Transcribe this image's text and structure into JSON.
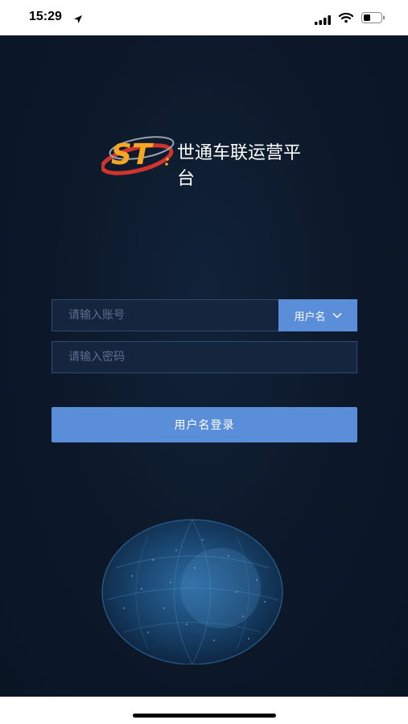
{
  "status_bar": {
    "time": "15:29",
    "icons": [
      "location-arrow-icon",
      "cellular-signal-icon",
      "wifi-icon",
      "battery-icon"
    ]
  },
  "logo": {
    "mark_text": "ST",
    "title": "世通车联运营平台"
  },
  "form": {
    "account_placeholder": "请输入账号",
    "login_type_label": "用户名",
    "password_placeholder": "请输入密码",
    "login_button_label": "用户名登录"
  },
  "colors": {
    "background": "#0c1829",
    "input_background": "#14253d",
    "input_border": "#2f4a73",
    "accent": "#5b8ed8",
    "logo_orange": "#f5a623",
    "logo_red": "#d0342c"
  }
}
